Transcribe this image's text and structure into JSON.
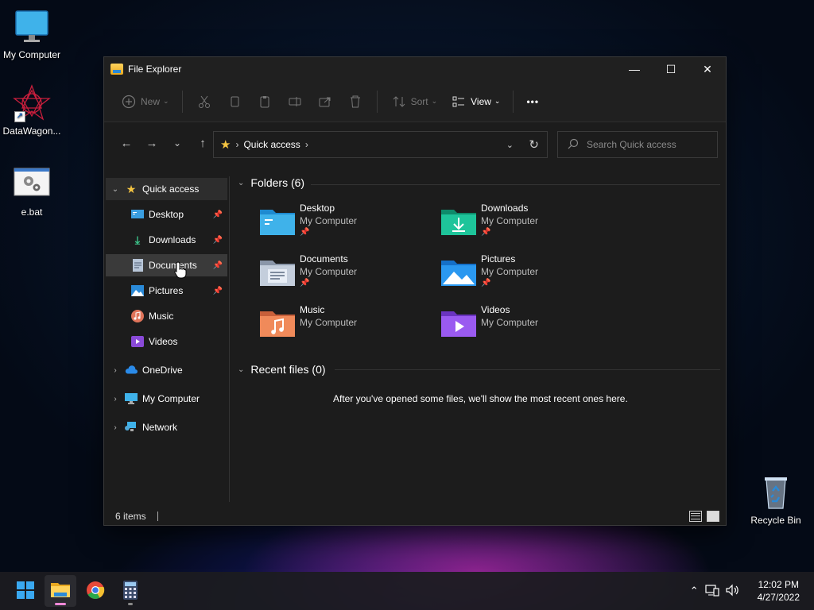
{
  "desktop": {
    "icons": [
      {
        "label": "My Computer"
      },
      {
        "label": "DataWagon..."
      },
      {
        "label": "e.bat"
      },
      {
        "label": "Recycle Bin"
      }
    ]
  },
  "window": {
    "title": "File Explorer",
    "controls": {
      "minimize": "—",
      "maximize": "☐",
      "close": "✕"
    }
  },
  "toolbar": {
    "new_label": "New",
    "sort_label": "Sort",
    "view_label": "View",
    "more_label": "•••"
  },
  "address": {
    "location": "Quick access",
    "search_placeholder": "Search Quick access"
  },
  "sidebar": {
    "items": [
      {
        "label": "Quick access"
      },
      {
        "label": "Desktop"
      },
      {
        "label": "Downloads"
      },
      {
        "label": "Documents"
      },
      {
        "label": "Pictures"
      },
      {
        "label": "Music"
      },
      {
        "label": "Videos"
      },
      {
        "label": "OneDrive"
      },
      {
        "label": "My Computer"
      },
      {
        "label": "Network"
      }
    ]
  },
  "content": {
    "folders_header": "Folders (6)",
    "recent_header": "Recent files (0)",
    "recent_empty": "After you've opened some files, we'll show the most recent ones here.",
    "folders": [
      {
        "name": "Desktop",
        "location": "My Computer",
        "pinned": "📌"
      },
      {
        "name": "Downloads",
        "location": "My Computer",
        "pinned": "📌"
      },
      {
        "name": "Documents",
        "location": "My Computer",
        "pinned": "📌"
      },
      {
        "name": "Pictures",
        "location": "My Computer",
        "pinned": "📌"
      },
      {
        "name": "Music",
        "location": "My Computer"
      },
      {
        "name": "Videos",
        "location": "My Computer"
      }
    ]
  },
  "status": {
    "items": "6 items"
  },
  "taskbar": {
    "time": "12:02 PM",
    "date": "4/27/2022"
  },
  "colors": {
    "accent": "#ef88d8",
    "folder_yellow": "#f5c542",
    "window_bg": "#1c1c1c"
  }
}
